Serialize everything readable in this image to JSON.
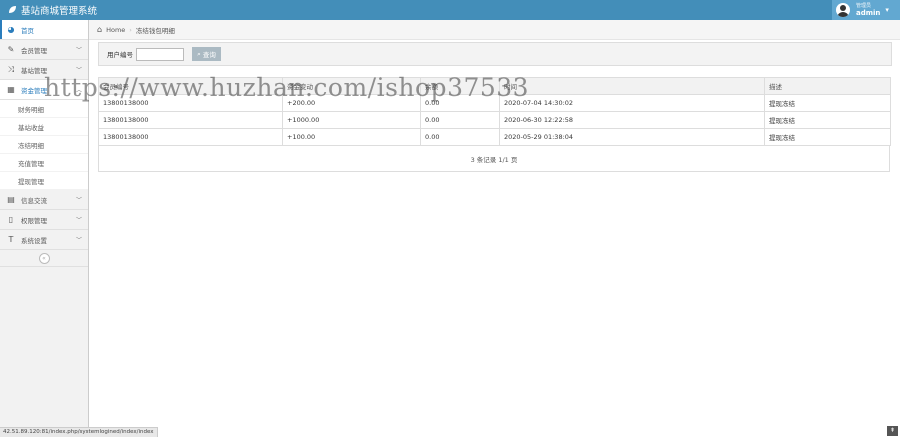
{
  "header": {
    "brand": "基站商城管理系统",
    "user_role": "管理员",
    "user_name": "admin"
  },
  "sidebar": {
    "items": [
      {
        "label": "首页",
        "icon": "tachometer-icon"
      },
      {
        "label": "会员管理",
        "icon": "edit-icon"
      },
      {
        "label": "基站管理",
        "icon": "random-icon"
      },
      {
        "label": "资金管理",
        "icon": "calendar-icon"
      }
    ],
    "sub_items": [
      "财务明细",
      "基站收益",
      "冻结明细",
      "充值管理",
      "提现管理"
    ],
    "items_after": [
      {
        "label": "信息交流",
        "icon": "list-icon"
      },
      {
        "label": "权限管理",
        "icon": "file-icon"
      },
      {
        "label": "系统设置",
        "icon": "text-icon"
      }
    ]
  },
  "breadcrumb": {
    "home": "Home",
    "current": "冻结钱包明细"
  },
  "filter": {
    "label": "用户编号",
    "value": "",
    "search_button": "查询"
  },
  "table": {
    "headers": [
      "会员编号",
      "资金变动",
      "余额",
      "时间",
      "描述"
    ],
    "rows": [
      [
        "13800138000",
        "+200.00",
        "0.00",
        "2020-07-04 14:30:02",
        "提现冻结"
      ],
      [
        "13800138000",
        "+1000.00",
        "0.00",
        "2020-06-30 12:22:58",
        "提现冻结"
      ],
      [
        "13800138000",
        "+100.00",
        "0.00",
        "2020-05-29 01:38:04",
        "提现冻结"
      ]
    ]
  },
  "pager": "3 条记录 1/1 页",
  "status_url": "42.51.89.120:81/index.php/systemlogined/index/index",
  "watermark": "https://www.huzhan.com/ishop37533"
}
